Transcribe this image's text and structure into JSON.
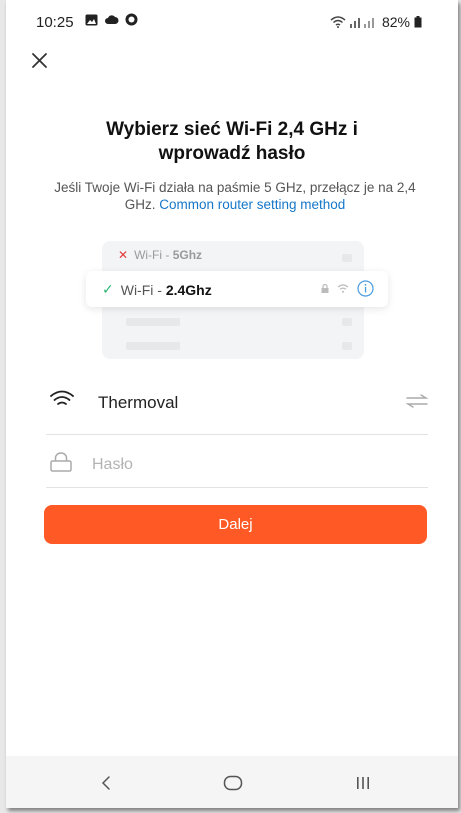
{
  "status_bar": {
    "time": "10:25",
    "battery": "82%"
  },
  "header": {
    "title_line1": "Wybierz sieć Wi-Fi 2,4 GHz i",
    "title_line2": "wprowadź hasło",
    "subtitle": "Jeśli Twoje Wi-Fi działa na paśmie 5 GHz, przełącz je na 2,4 GHz. ",
    "subtitle_link": "Common router setting method"
  },
  "illustration": {
    "row_5g_prefix": "Wi-Fi - ",
    "row_5g_band": "5Ghz",
    "row_24_prefix": "Wi-Fi - ",
    "row_24_band": "2.4Ghz"
  },
  "form": {
    "wifi_name": "Thermoval",
    "password_placeholder": "Hasło",
    "password_value": "",
    "next_label": "Dalej"
  },
  "colors": {
    "accent": "#ff5a26",
    "link": "#1677c8",
    "ok": "#2bb673",
    "error": "#e23a3a"
  },
  "icons": {
    "close": "close-icon",
    "wifi": "wifi-icon",
    "lock": "lock-icon",
    "switch": "switch-network-icon",
    "nav_back": "back-icon",
    "nav_home": "home-icon",
    "nav_recents": "recents-icon"
  }
}
